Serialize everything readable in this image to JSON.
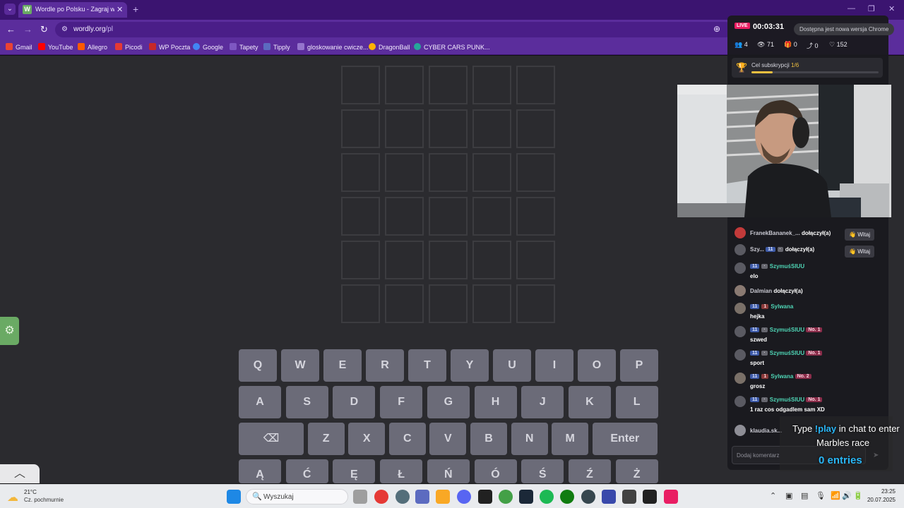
{
  "browser": {
    "tab": {
      "title": "Wordle po Polsku - Zagraj w W...",
      "favicon_letter": "W"
    },
    "url_domain": "wordly.org",
    "url_path": "/pl",
    "bookmarks": [
      {
        "label": "Gmail",
        "color": "#ea4335"
      },
      {
        "label": "YouTube",
        "color": "#ff0000"
      },
      {
        "label": "Allegro",
        "color": "#ff5a00"
      },
      {
        "label": "Picodi",
        "color": "#e53935"
      },
      {
        "label": "WP Poczta",
        "color": "#c62828"
      },
      {
        "label": "Google",
        "color": "#4285f4"
      },
      {
        "label": "Tapety",
        "color": "#7e57c2"
      },
      {
        "label": "Tipply",
        "color": "#5c6bc0"
      },
      {
        "label": "gloskowanie cwicze...",
        "color": "#9575cd"
      },
      {
        "label": "DragonBall",
        "color": "#ffb300"
      },
      {
        "label": "CYBER CARS PUNK...",
        "color": "#26a69a"
      }
    ]
  },
  "game": {
    "rows": 6,
    "cols": 5,
    "keyboard": {
      "row1": [
        "Q",
        "W",
        "E",
        "R",
        "T",
        "Y",
        "U",
        "I",
        "O",
        "P"
      ],
      "row2": [
        "A",
        "S",
        "D",
        "F",
        "G",
        "H",
        "J",
        "K",
        "L"
      ],
      "row3": [
        "⌫",
        "Z",
        "X",
        "C",
        "V",
        "B",
        "N",
        "M",
        "Enter"
      ],
      "row4": [
        "Ą",
        "Ć",
        "Ę",
        "Ł",
        "Ń",
        "Ó",
        "Ś",
        "Ź",
        "Ż"
      ]
    }
  },
  "stream": {
    "live_label": "LIVE",
    "timer": "00:03:31",
    "update_note": "Dostępna jest nowa wersja Chrome",
    "stats": {
      "users": "4",
      "views": "71",
      "gifts": "0",
      "shares": "0",
      "likes": "152"
    },
    "sub_goal": {
      "label": "Cel subskrypcji",
      "count": "1/6",
      "progress": 0.167
    },
    "chat": [
      {
        "name": "FranekBananek_...",
        "text": "dołączył(a)",
        "join": true,
        "button": "Witaj"
      },
      {
        "name": "Szy...",
        "badges": [
          "11",
          "·"
        ],
        "text": "dołączył(a)",
        "join": true,
        "button": "Witaj"
      },
      {
        "name": "SzymuśSIUU",
        "badges": [
          "11",
          "·"
        ],
        "text": "elo"
      },
      {
        "name": "Dalmian",
        "text": "dołączył(a)",
        "join": true
      },
      {
        "name": "Sylwana",
        "badges": [
          "11",
          "1"
        ],
        "text": "hejka"
      },
      {
        "name": "SzymuśSIUU",
        "badges": [
          "11",
          "·"
        ],
        "rank": "No. 1",
        "text": "szwed"
      },
      {
        "name": "SzymuśSIUU",
        "badges": [
          "11",
          "·"
        ],
        "rank": "No. 1",
        "text": "sport"
      },
      {
        "name": "Sylwana",
        "badges": [
          "11",
          "1"
        ],
        "rank": "No. 2",
        "text": "grosz"
      },
      {
        "name": "SzymuśSIUU",
        "badges": [
          "11",
          "·"
        ],
        "rank": "No. 1",
        "text": "1 raz cos odgadlem sam XD"
      },
      {
        "name": "klaudia.sk...",
        "text": ""
      }
    ],
    "comment_placeholder": "Dodaj komentarz",
    "marbles": {
      "line1_pre": "Type ",
      "cmd": "!play",
      "line1_post": " in chat to enter",
      "line2": "Marbles race",
      "count": "0 entries"
    }
  },
  "taskbar": {
    "weather_temp": "21°C",
    "weather_desc": "Cz. pochmurnie",
    "search_placeholder": "Wyszukaj",
    "time": "23:25",
    "date": "20.07.2025"
  }
}
